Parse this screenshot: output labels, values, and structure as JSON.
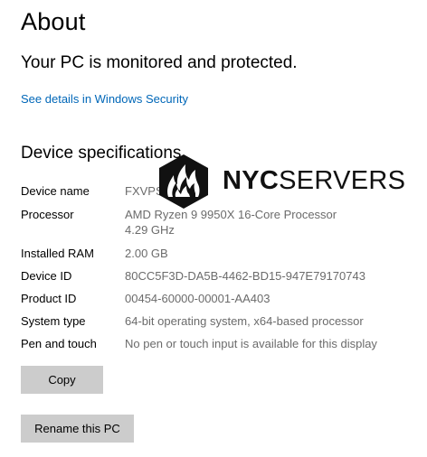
{
  "page": {
    "title": "About",
    "protection_status": "Your PC is monitored and protected.",
    "security_link": "See details in Windows Security"
  },
  "specs": {
    "heading": "Device specifications",
    "rows": [
      {
        "label": "Device name",
        "value": "FXVPS"
      },
      {
        "label": "Processor",
        "value": "AMD Ryzen 9 9950X 16-Core Processor",
        "value_line2": "4.29 GHz"
      },
      {
        "label": "Installed RAM",
        "value": "2.00 GB"
      },
      {
        "label": "Device ID",
        "value": "80CC5F3D-DA5B-4462-BD15-947E79170743"
      },
      {
        "label": "Product ID",
        "value": "00454-60000-00001-AA403"
      },
      {
        "label": "System type",
        "value": "64-bit operating system, x64-based processor"
      },
      {
        "label": "Pen and touch",
        "value": "No pen or touch input is available for this display"
      }
    ]
  },
  "buttons": {
    "copy": "Copy",
    "rename": "Rename this PC"
  },
  "watermark": {
    "brand_bold": "NYC",
    "brand_light": "SERVERS"
  },
  "colors": {
    "link": "#0067b8",
    "value_text": "#6b6b6b",
    "button_bg": "#cccccc"
  }
}
